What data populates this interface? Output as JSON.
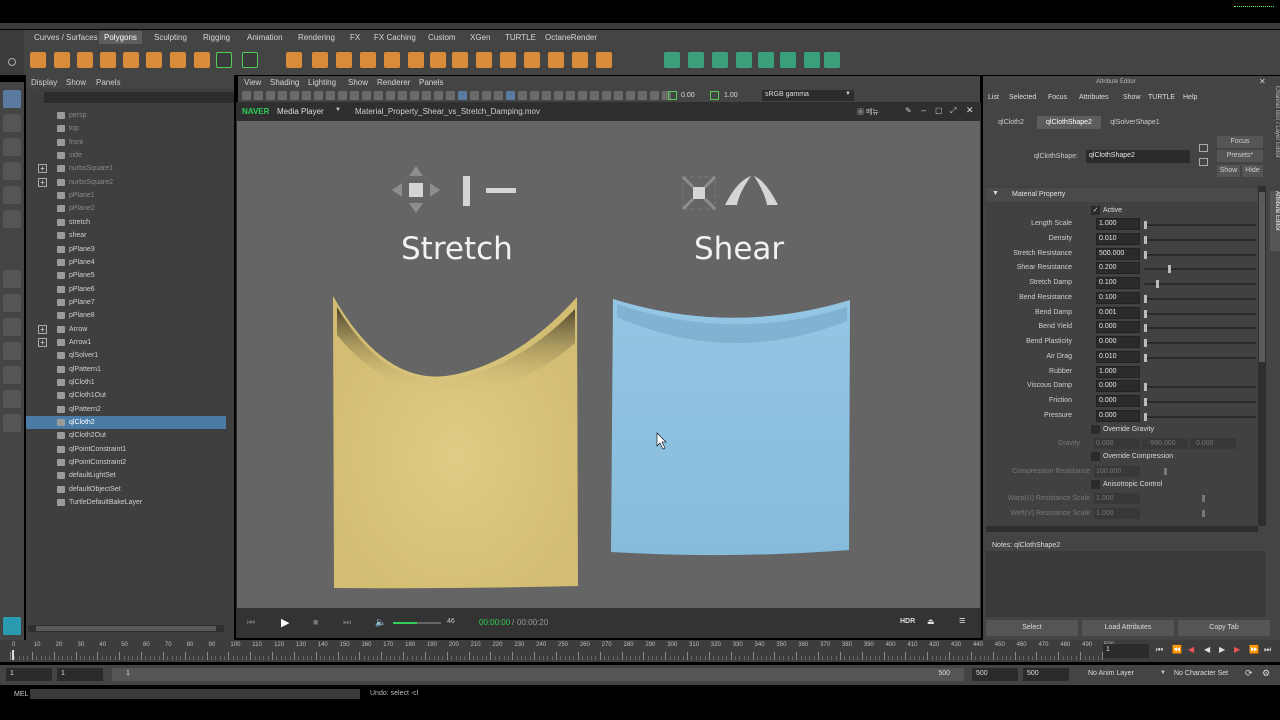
{
  "menubar": {
    "tabs": [
      "Curves / Surfaces",
      "Polygons",
      "Sculpting",
      "Rigging",
      "Animation",
      "Rendering",
      "FX",
      "FX Caching",
      "Custom",
      "XGen",
      "TURTLE",
      "OctaneRender"
    ],
    "active": "Polygons"
  },
  "outliner": {
    "menu": [
      "Display",
      "Show",
      "Panels"
    ],
    "items": [
      {
        "label": "persp",
        "dim": true,
        "exp": false
      },
      {
        "label": "top",
        "dim": true,
        "exp": false
      },
      {
        "label": "front",
        "dim": true,
        "exp": false
      },
      {
        "label": "side",
        "dim": true,
        "exp": false
      },
      {
        "label": "nurbsSquare1",
        "dim": true,
        "exp": true
      },
      {
        "label": "nurbsSquare2",
        "dim": true,
        "exp": true
      },
      {
        "label": "pPlane1",
        "dim": true,
        "exp": false
      },
      {
        "label": "pPlane2",
        "dim": true,
        "exp": false
      },
      {
        "label": "stretch",
        "dim": false,
        "exp": false
      },
      {
        "label": "shear",
        "dim": false,
        "exp": false
      },
      {
        "label": "pPlane3",
        "dim": false,
        "exp": false
      },
      {
        "label": "pPlane4",
        "dim": false,
        "exp": false
      },
      {
        "label": "pPlane5",
        "dim": false,
        "exp": false
      },
      {
        "label": "pPlane6",
        "dim": false,
        "exp": false
      },
      {
        "label": "pPlane7",
        "dim": false,
        "exp": false
      },
      {
        "label": "pPlane8",
        "dim": false,
        "exp": false
      },
      {
        "label": "Arrow",
        "dim": false,
        "exp": true
      },
      {
        "label": "Arrow1",
        "dim": false,
        "exp": true
      },
      {
        "label": "qlSolver1",
        "dim": false,
        "exp": false
      },
      {
        "label": "qlPattern1",
        "dim": false,
        "exp": false
      },
      {
        "label": "qlCloth1",
        "dim": false,
        "exp": false
      },
      {
        "label": "qlCloth1Out",
        "dim": false,
        "exp": false
      },
      {
        "label": "qlPattern2",
        "dim": false,
        "exp": false
      },
      {
        "label": "qlCloth2",
        "dim": false,
        "exp": false,
        "selected": true
      },
      {
        "label": "qlCloth2Out",
        "dim": false,
        "exp": false
      },
      {
        "label": "qlPointConstraint1",
        "dim": false,
        "exp": false
      },
      {
        "label": "qlPointConstraint2",
        "dim": false,
        "exp": false
      },
      {
        "label": "defaultLightSet",
        "dim": false,
        "exp": false
      },
      {
        "label": "defaultObjectSet",
        "dim": false,
        "exp": false
      },
      {
        "label": "TurtleDefaultBakeLayer",
        "dim": false,
        "exp": false
      }
    ]
  },
  "viewport": {
    "menu": [
      "View",
      "Shading",
      "Lighting",
      "Show",
      "Renderer",
      "Panels"
    ],
    "val1": "0.00",
    "val2": "1.00",
    "colorspace": "sRGB gamma"
  },
  "player": {
    "brand": "NAVER",
    "brand_suffix": "Media Player",
    "filename": "Material_Property_Shear_vs_Stretch_Damping.mov",
    "menu_label": "메뉴",
    "stretch_label": "Stretch",
    "shear_label": "Shear",
    "volume": "46",
    "volume_level": 0.5,
    "time_current": "00:00:00",
    "time_sep": "/",
    "time_total": "00:00:20",
    "hdr": "HDR",
    "cloth_colors": {
      "stretch": "#d9c47a",
      "shear": "#8cc0df"
    }
  },
  "attr": {
    "title": "Attribute Editor",
    "menu": [
      "List",
      "Selected",
      "Focus",
      "Attributes",
      "Show",
      "TURTLE",
      "Help"
    ],
    "tabs": [
      "qlCloth2",
      "qlClothShape2",
      "qlSolverShape1"
    ],
    "active_tab": "qlClothShape2",
    "node_label": "qlClothShape:",
    "node_value": "qlClothShape2",
    "focus": "Focus",
    "presets": "Presets*",
    "show": "Show",
    "hide": "Hide",
    "section": "Material Property",
    "active_label": "Active",
    "attrs": [
      {
        "label": "Length Scale",
        "value": "1.000",
        "knob": 0.0
      },
      {
        "label": "Density",
        "value": "0.010",
        "knob": 0.0
      },
      {
        "label": "Stretch Resistance",
        "value": "500.000",
        "knob": 0.0
      },
      {
        "label": "Shear Resistance",
        "value": "0.200",
        "knob": 0.22
      },
      {
        "label": "Stretch Damp",
        "value": "0.100",
        "knob": 0.11
      },
      {
        "label": "Bend Resistance",
        "value": "0.100",
        "knob": 0.0
      },
      {
        "label": "Bend Damp",
        "value": "0.001",
        "knob": 0.0
      },
      {
        "label": "Bend Yield",
        "value": "0.000",
        "knob": 0.0
      },
      {
        "label": "Bend Plasticity",
        "value": "0.000",
        "knob": 0.0
      },
      {
        "label": "Air Drag",
        "value": "0.010",
        "knob": 0.0
      },
      {
        "label": "Rubber",
        "value": "1.000",
        "knob": null
      },
      {
        "label": "Viscous Damp",
        "value": "0.000",
        "knob": 0.0
      },
      {
        "label": "Friction",
        "value": "0.000",
        "knob": 0.0
      },
      {
        "label": "Pressure",
        "value": "0.000",
        "knob": 0.0
      }
    ],
    "override_gravity": "Override Gravity",
    "gravity_label": "Gravity",
    "gravity_vals": [
      "0.000",
      "-980.000",
      "0.000"
    ],
    "override_compression": "Override Compression",
    "compression_label": "Compression Resistance",
    "compression_value": "100.000",
    "anisotropic": "Anisotropic Control",
    "warp_label": "Warp(U) Resistance Scale",
    "warp_value": "1.000",
    "weft_label": "Weft(V) Resistance Scale",
    "weft_value": "1.000",
    "notes": "Notes:  qlClothShape2",
    "bottom_buttons": [
      "Select",
      "Load Attributes",
      "Copy Tab"
    ],
    "side_tabs": [
      "Channel Box / Layer Editor",
      "Attribute Editor"
    ]
  },
  "timeline": {
    "ticks": [
      "0",
      "10",
      "20",
      "30",
      "40",
      "50",
      "60",
      "70",
      "80",
      "90",
      "100",
      "110",
      "120",
      "130",
      "140",
      "150",
      "160",
      "170",
      "180",
      "190",
      "200",
      "210",
      "220",
      "230",
      "240",
      "250",
      "260",
      "270",
      "280",
      "290",
      "300",
      "310",
      "320",
      "330",
      "340",
      "350",
      "360",
      "370",
      "380",
      "390",
      "400",
      "410",
      "420",
      "430",
      "440",
      "450",
      "460",
      "470",
      "480",
      "490",
      "500"
    ],
    "current": "1"
  },
  "range": {
    "start": "1",
    "start2": "1",
    "slider_start": "1",
    "slider_end": "500",
    "end": "500",
    "end2": "500",
    "anim_layer": "No Anim Layer",
    "char_set": "No Character Set"
  },
  "cmd": {
    "label": "MEL",
    "help": "Undo: select -cl"
  }
}
